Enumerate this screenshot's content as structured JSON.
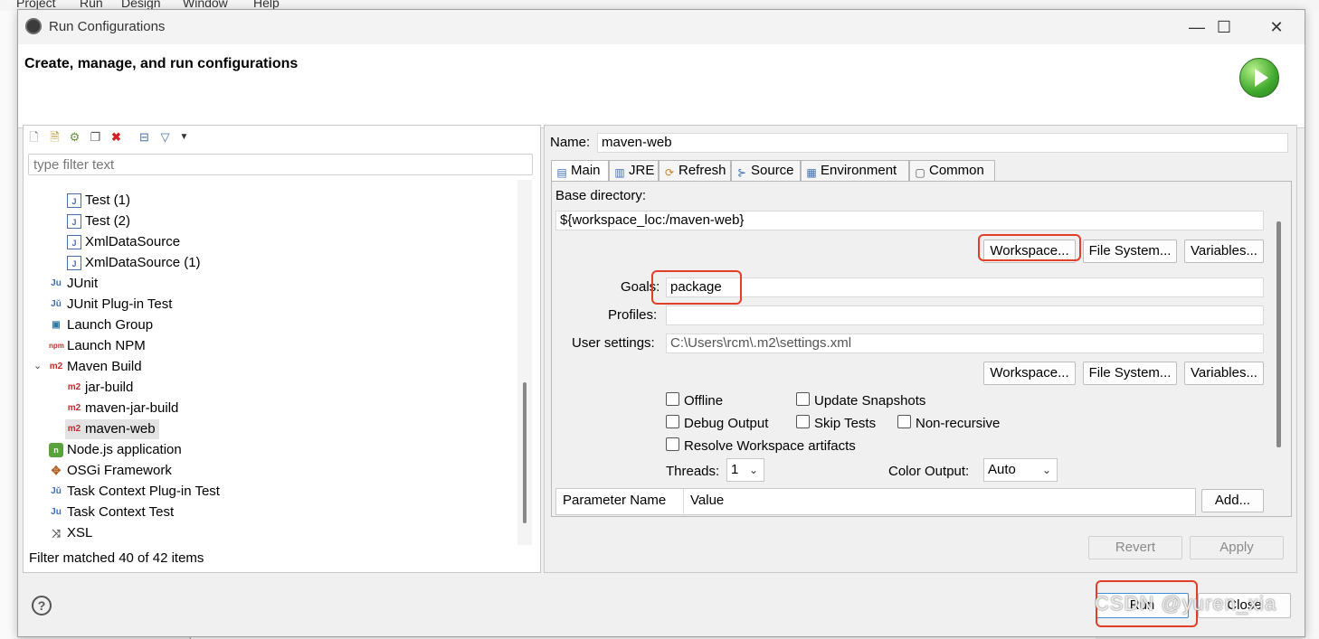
{
  "background": {
    "menu": [
      "Project",
      "Run",
      "Design",
      "Window",
      "Help"
    ]
  },
  "window": {
    "title": "Run Configurations",
    "controls": {
      "minimize": "—",
      "maximize": "☐",
      "close": "✕"
    }
  },
  "header": {
    "title": "Create, manage, and run configurations"
  },
  "left": {
    "filter_placeholder": "type filter text",
    "tree": [
      {
        "label": "Test (1)",
        "icon": "junit-test-icon"
      },
      {
        "label": "Test (2)",
        "icon": "junit-test-icon"
      },
      {
        "label": "XmlDataSource",
        "icon": "junit-test-icon"
      },
      {
        "label": "XmlDataSource (1)",
        "icon": "junit-test-icon"
      },
      {
        "label": "JUnit",
        "icon": "junit-icon"
      },
      {
        "label": "JUnit Plug-in Test",
        "icon": "junit-plugin-icon"
      },
      {
        "label": "Launch Group",
        "icon": "launch-group-icon"
      },
      {
        "label": "Launch NPM",
        "icon": "npm-icon"
      },
      {
        "label": "Maven Build",
        "icon": "maven-icon"
      },
      {
        "label": "jar-build",
        "icon": "maven-icon"
      },
      {
        "label": "maven-jar-build",
        "icon": "maven-icon"
      },
      {
        "label": "maven-web",
        "icon": "maven-icon"
      },
      {
        "label": "Node.js application",
        "icon": "nodejs-icon"
      },
      {
        "label": "OSGi Framework",
        "icon": "osgi-icon"
      },
      {
        "label": "Task Context Plug-in Test",
        "icon": "task-plugin-icon"
      },
      {
        "label": "Task Context Test",
        "icon": "task-test-icon"
      },
      {
        "label": "XSL",
        "icon": "xsl-icon"
      }
    ],
    "status": "Filter matched 40 of 42 items"
  },
  "right": {
    "name_label": "Name:",
    "name_value": "maven-web",
    "tabs": [
      {
        "label": "Main",
        "icon": "main-tab-icon"
      },
      {
        "label": "JRE",
        "icon": "jre-tab-icon"
      },
      {
        "label": "Refresh",
        "icon": "refresh-tab-icon"
      },
      {
        "label": "Source",
        "icon": "source-tab-icon"
      },
      {
        "label": "Environment",
        "icon": "environment-tab-icon"
      },
      {
        "label": "Common",
        "icon": "common-tab-icon"
      }
    ],
    "base_dir_label": "Base directory:",
    "base_dir_value": "${workspace_loc:/maven-web}",
    "workspace_btn": "Workspace...",
    "filesystem_btn": "File System...",
    "variables_btn": "Variables...",
    "goals_label": "Goals:",
    "goals_value": "package",
    "profiles_label": "Profiles:",
    "profiles_value": "",
    "user_settings_label": "User settings:",
    "user_settings_value": "C:\\Users\\rcm\\.m2\\settings.xml",
    "checkboxes": {
      "offline": "Offline",
      "update_snapshots": "Update Snapshots",
      "debug_output": "Debug Output",
      "skip_tests": "Skip Tests",
      "non_recursive": "Non-recursive",
      "resolve_workspace": "Resolve Workspace artifacts"
    },
    "threads_label": "Threads:",
    "threads_value": "1",
    "color_output_label": "Color Output:",
    "color_output_value": "Auto",
    "param_col_name": "Parameter Name",
    "param_col_value": "Value",
    "add_btn": "Add...",
    "revert_btn": "Revert",
    "apply_btn": "Apply"
  },
  "footer": {
    "run_btn": "Run",
    "close_btn": "Close",
    "watermark": "CSDN @yuren_xia"
  },
  "colors": {
    "highlight_red": "#e0402a",
    "selection": "#e3e3e3",
    "maven_red": "#c62b2b"
  }
}
